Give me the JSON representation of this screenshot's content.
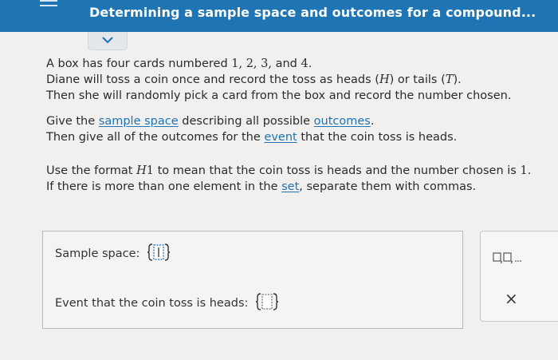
{
  "header": {
    "title": "Determining a sample space and outcomes for a compound..."
  },
  "problem": {
    "line1_prefix": "A box has four cards numbered ",
    "line1_nums": "1, 2, 3,",
    "line1_and": " and ",
    "line1_last": "4",
    "line1_end": ".",
    "line2_a": "Diane will toss a coin once and record the toss as heads (",
    "line2_h": "H",
    "line2_b": ") or tails (",
    "line2_t": "T",
    "line2_c": ").",
    "line3": "Then she will randomly pick a card from the box and record the number chosen.",
    "line4_a": "Give the ",
    "line4_link1": "sample space",
    "line4_b": " describing all possible ",
    "line4_link2": "outcomes",
    "line4_c": ".",
    "line5_a": "Then give all of the outcomes for the ",
    "line5_link": "event",
    "line5_b": " that the coin toss is heads.",
    "line6_a": "Use the format ",
    "line6_h": "H",
    "line6_1": "1",
    "line6_b": " to mean that the coin toss is heads and the number chosen is ",
    "line6_num": "1",
    "line6_c": ".",
    "line7_a": "If there is more than one element in the ",
    "line7_link": "set",
    "line7_b": ", separate them with commas."
  },
  "answer": {
    "sample_space_label": "Sample space:",
    "event_label": "Event that the coin toss is heads:"
  },
  "tools": {
    "palette_icon": "set-list-icon",
    "clear_icon": "close-icon",
    "clear_label": "×"
  },
  "colors": {
    "header": "#1f74b3",
    "link": "#1f74b3",
    "background": "#f1f0ee"
  }
}
